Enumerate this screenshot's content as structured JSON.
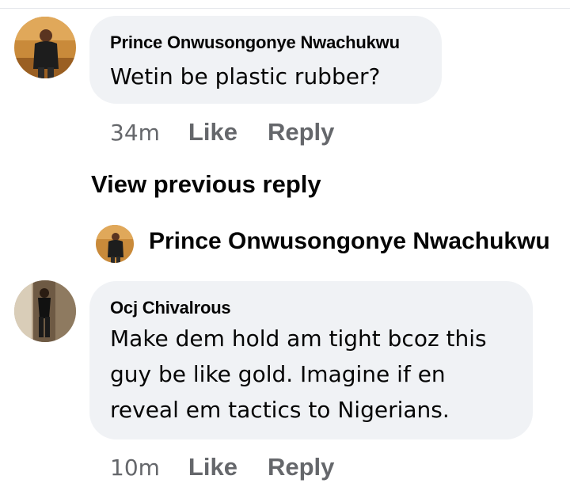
{
  "comments": [
    {
      "author": "Prince Onwusongonye Nwachukwu",
      "lines": [
        "Wetin be plastic rubber?"
      ],
      "time": "34m",
      "like_label": "Like",
      "reply_label": "Reply"
    },
    {
      "author": "Ocj Chivalrous",
      "lines": [
        "Make dem hold am tight bcoz this",
        "guy be like gold. Imagine if en",
        "reveal em tactics to Nigerians."
      ],
      "time": "10m",
      "like_label": "Like",
      "reply_label": "Reply"
    }
  ],
  "view_previous_reply_label": "View previous reply",
  "reply_preview": {
    "author": "Prince Onwusongonye Nwachukwu"
  }
}
